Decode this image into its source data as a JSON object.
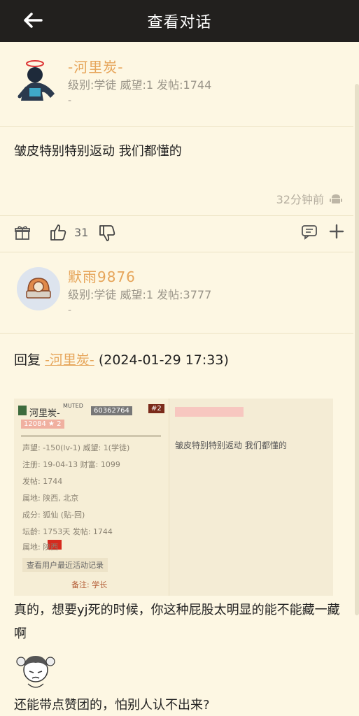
{
  "header": {
    "title": "查看对话",
    "back_icon": "arrow-left-icon"
  },
  "posts": [
    {
      "username": "-河里炭-",
      "stats": "级别:学徒 威望:1 发帖:1744",
      "dash": "-",
      "content": "皱皮特别特别返动 我们都懂的",
      "time": "32分钟前",
      "likes": "31"
    },
    {
      "username": "默雨9876",
      "stats": "级别:学徒 威望:1 发帖:3777",
      "dash": "-",
      "reply_prefix": "回复",
      "reply_user": "-河里炭-",
      "reply_time": "(2024-01-29 17:33)",
      "quote_shot": {
        "name": "河里炭-",
        "muted": "MUTED",
        "uid": "60362764",
        "floor": "#2",
        "badges": "12084 ★ 2",
        "lines": [
          "声望: -150(lv-1) 威望: 1(学徒)",
          "注册: 19-04-13   财富: 1099",
          "发帖: 1744",
          "属地: 陕西, 北京",
          "成分: 狐仙 (贴-回)",
          "坛龄: 1753天   发帖: 1744",
          "属地: 陕西",
          "查看用户最近活动记录",
          "备注: 学长"
        ],
        "quoted_text": "皱皮特别特别返动 我们都懂的"
      },
      "paragraph1": "真的，想要yj死的时候，你这种屁股太明显的能不能藏一藏啊",
      "paragraph2": "还能带点赞团的，怕别人认不出来?"
    }
  ],
  "colors": {
    "accent": "#e6a55a",
    "background": "#fdf7e3",
    "topbar": "#22201e"
  }
}
